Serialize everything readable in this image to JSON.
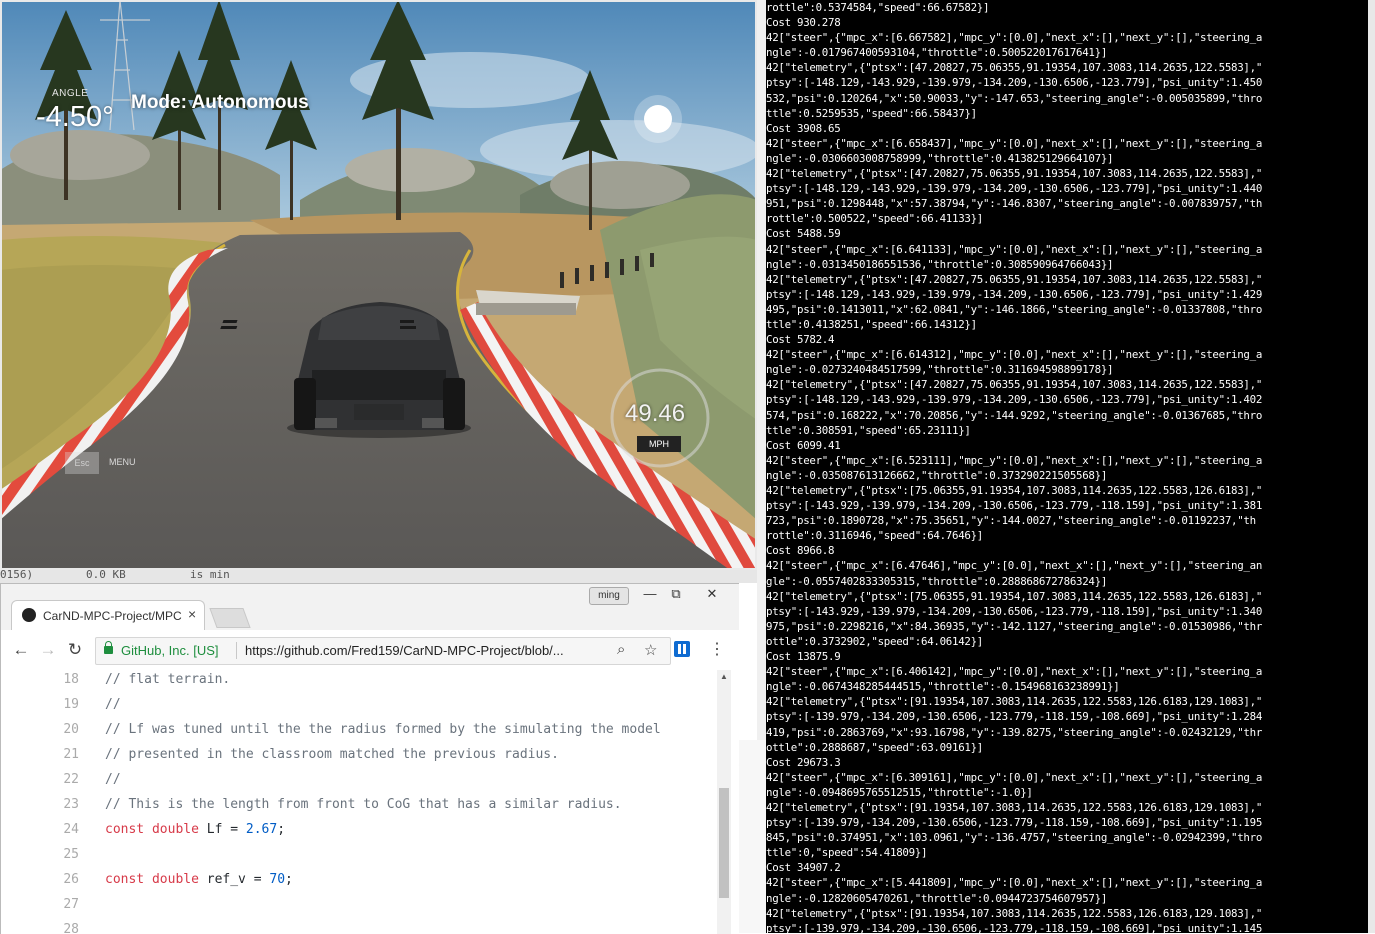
{
  "simulator": {
    "angle_label": "ANGLE",
    "angle_value": "-4.50°",
    "mode": "Mode: Autonomous",
    "speed_value": "49.46",
    "speed_unit": "MPH",
    "esc_label": "Esc",
    "menu_label": "MENU"
  },
  "background_window": {
    "fragment_1": "0156)",
    "fragment_2": "0.0 KB",
    "fragment_3": "is min"
  },
  "browser": {
    "tab_title": "CarND-MPC-Project/MPC",
    "user_badge": "ming",
    "window_controls": {
      "minimize": "—",
      "restore": "⧉",
      "close": "✕"
    },
    "site_identity": "GitHub, Inc. [US]",
    "url": "https://github.com/Fred159/CarND-MPC-Project/blob/...",
    "code_lines": [
      {
        "num": "18",
        "text": "// flat terrain.",
        "type": "comment"
      },
      {
        "num": "19",
        "text": "//",
        "type": "comment"
      },
      {
        "num": "20",
        "text": "// Lf was tuned until the the radius formed by the simulating the model",
        "type": "comment"
      },
      {
        "num": "21",
        "text": "// presented in the classroom matched the previous radius.",
        "type": "comment"
      },
      {
        "num": "22",
        "text": "//",
        "type": "comment"
      },
      {
        "num": "23",
        "text": "// This is the length from front to CoG that has a similar radius.",
        "type": "comment"
      },
      {
        "num": "24",
        "kw": "const double",
        "name": " Lf = ",
        "val": "2.67",
        "end": ";",
        "type": "code"
      },
      {
        "num": "25",
        "text": "",
        "type": "comment"
      },
      {
        "num": "26",
        "kw": "const double",
        "name": " ref_v = ",
        "val": "70",
        "end": ";",
        "type": "code"
      },
      {
        "num": "27",
        "text": "",
        "type": "comment"
      },
      {
        "num": "28",
        "text": "",
        "type": "comment"
      }
    ]
  },
  "terminal": {
    "lines": [
      "rottle\":0.5374584,\"speed\":66.67582}]",
      "Cost 930.278",
      "42[\"steer\",{\"mpc_x\":[6.667582],\"mpc_y\":[0.0],\"next_x\":[],\"next_y\":[],\"steering_a",
      "ngle\":-0.01796740059310​4,\"throttle\":0.500522017617641}]",
      "42[\"telemetry\",{\"ptsx\":[47.20827,75.06355,91.19354,107.3083,114.2635,122.5583],\"",
      "ptsy\":[-148.129,-143.929,-139.979,-134.209,-130.6506,-123.779],\"psi_unity\":1.450",
      "532,\"psi\":0.120264,\"x\":50.90033,\"y\":-147.653,\"steering_angle\":-0.005035899,\"thro",
      "ttle\":0.5259535,\"speed\":66.58437}]",
      "Cost 3908.65",
      "42[\"steer\",{\"mpc_x\":[6.658437],\"mpc_y\":[0.0],\"next_x\":[],\"next_y\":[],\"steering_a",
      "ngle\":-0.0306603008758999,\"throttle\":0.413825129664107}]",
      "42[\"telemetry\",{\"ptsx\":[47.20827,75.06355,91.19354,107.3083,114.2635,122.5583],\"",
      "ptsy\":[-148.129,-143.929,-139.979,-134.209,-130.6506,-123.779],\"psi_unity\":1.440",
      "951,\"psi\":0.1298448,\"x\":57.38794,\"y\":-146.8307,\"steering_angle\":-0.007839757,\"th",
      "rottle\":0.500522,\"speed\":66.41133}]",
      "Cost 5488.59",
      "42[\"steer\",{\"mpc_x\":[6.641133],\"mpc_y\":[0.0],\"next_x\":[],\"next_y\":[],\"steering_a",
      "ngle\":-0.0313450186551536,\"throttle\":0.308590964766043}]",
      "42[\"telemetry\",{\"ptsx\":[47.20827,75.06355,91.19354,107.3083,114.2635,122.5583],\"",
      "ptsy\":[-148.129,-143.929,-139.979,-134.209,-130.6506,-123.779],\"psi_unity\":1.429",
      "495,\"psi\":0.1413011,\"x\":62.0841,\"y\":-146.1866,\"steering_angle\":-0.01337808,\"thro",
      "ttle\":0.4138251,\"speed\":66.14312}]",
      "Cost 5782.4",
      "42[\"steer\",{\"mpc_x\":[6.614312],\"mpc_y\":[0.0],\"next_x\":[],\"next_y\":[],\"steering_a",
      "ngle\":-0.0273240484517599,\"throttle\":0.311694598899178}]",
      "42[\"telemetry\",{\"ptsx\":[47.20827,75.06355,91.19354,107.3083,114.2635,122.5583],\"",
      "ptsy\":[-148.129,-143.929,-139.979,-134.209,-130.6506,-123.779],\"psi_unity\":1.402",
      "574,\"psi\":0.168222,\"x\":70.20856,\"y\":-144.9292,\"steering_angle\":-0.01367685,\"thro",
      "ttle\":0.308591,\"speed\":65.23111}]",
      "Cost 6099.41",
      "42[\"steer\",{\"mpc_x\":[6.523111],\"mpc_y\":[0.0],\"next_x\":[],\"next_y\":[],\"steering_a",
      "ngle\":-0.035087613126662,\"throttle\":0.373290221505568}]",
      "42[\"telemetry\",{\"ptsx\":[75.06355,91.19354,107.3083,114.2635,122.5583,126.6183],\"",
      "ptsy\":[-143.929,-139.979,-134.209,-130.6506,-123.779,-118.159],\"psi_unity\":1.381",
      "723,\"psi\":0.1890728,\"x\":75.35651,\"y\":-144.0027,\"steering_angle\":-0.01192237,\"th",
      "rottle\":0.3116946,\"speed\":64.7646}]",
      "Cost 8966.8",
      "42[\"steer\",{\"mpc_x\":[6.47646],\"mpc_y\":[0.0],\"next_x\":[],\"next_y\":[],\"steering_an",
      "gle\":-0.0557402833305315,\"throttle\":0.288868672786324}]",
      "42[\"telemetry\",{\"ptsx\":[75.06355,91.19354,107.3083,114.2635,122.5583,126.6183],\"",
      "ptsy\":[-143.929,-139.979,-134.209,-130.6506,-123.779,-118.159],\"psi_unity\":1.340",
      "975,\"psi\":0.2298216,\"x\":84.36935,\"y\":-142.1127,\"steering_angle\":-0.01530986,\"thr",
      "ottle\":0.3732902,\"speed\":64.06142}]",
      "Cost 13875.9",
      "42[\"steer\",{\"mpc_x\":[6.406142],\"mpc_y\":[0.0],\"next_x\":[],\"next_y\":[],\"steering_a",
      "ngle\":-0.0674348285444515,\"throttle\":-0.154968163238991}]",
      "42[\"telemetry\",{\"ptsx\":[91.19354,107.3083,114.2635,122.5583,126.6183,129.1083],\"",
      "ptsy\":[-139.979,-134.209,-130.6506,-123.779,-118.159,-108.669],\"psi_unity\":1.284",
      "419,\"psi\":0.2863769,\"x\":93.16798,\"y\":-139.8275,\"steering_angle\":-0.02432129,\"thr",
      "ottle\":0.2888687,\"speed\":63.09161}]",
      "Cost 29673.3",
      "42[\"steer\",{\"mpc_x\":[6.309161],\"mpc_y\":[0.0],\"next_x\":[],\"next_y\":[],\"steering_a",
      "ngle\":-0.0948695765512515,\"throttle\":-1.0}]",
      "42[\"telemetry\",{\"ptsx\":[91.19354,107.3083,114.2635,122.5583,126.6183,129.1083],\"",
      "ptsy\":[-139.979,-134.209,-130.6506,-123.779,-118.159,-108.669],\"psi_unity\":1.195",
      "845,\"psi\":0.374951,\"x\":103.0961,\"y\":-136.4757,\"steering_angle\":-0.02942399,\"thro",
      "ttle\":0,\"speed\":54.41809}]",
      "Cost 34907.2",
      "42[\"steer\",{\"mpc_x\":[5.441809],\"mpc_y\":[0.0],\"next_x\":[],\"next_y\":[],\"steering_a",
      "ngle\":-0.128206054702​61,\"throttle\":0.0944723754607957}]",
      "42[\"telemetry\",{\"ptsx\":[91.19354,107.3083,114.2635,122.5583,126.6183,129.1083],\"",
      "ptsy\":[-139.979,-134.209,-130.6506,-123.779,-118.159,-108.669],\"psi_unity\":1.145"
    ]
  }
}
